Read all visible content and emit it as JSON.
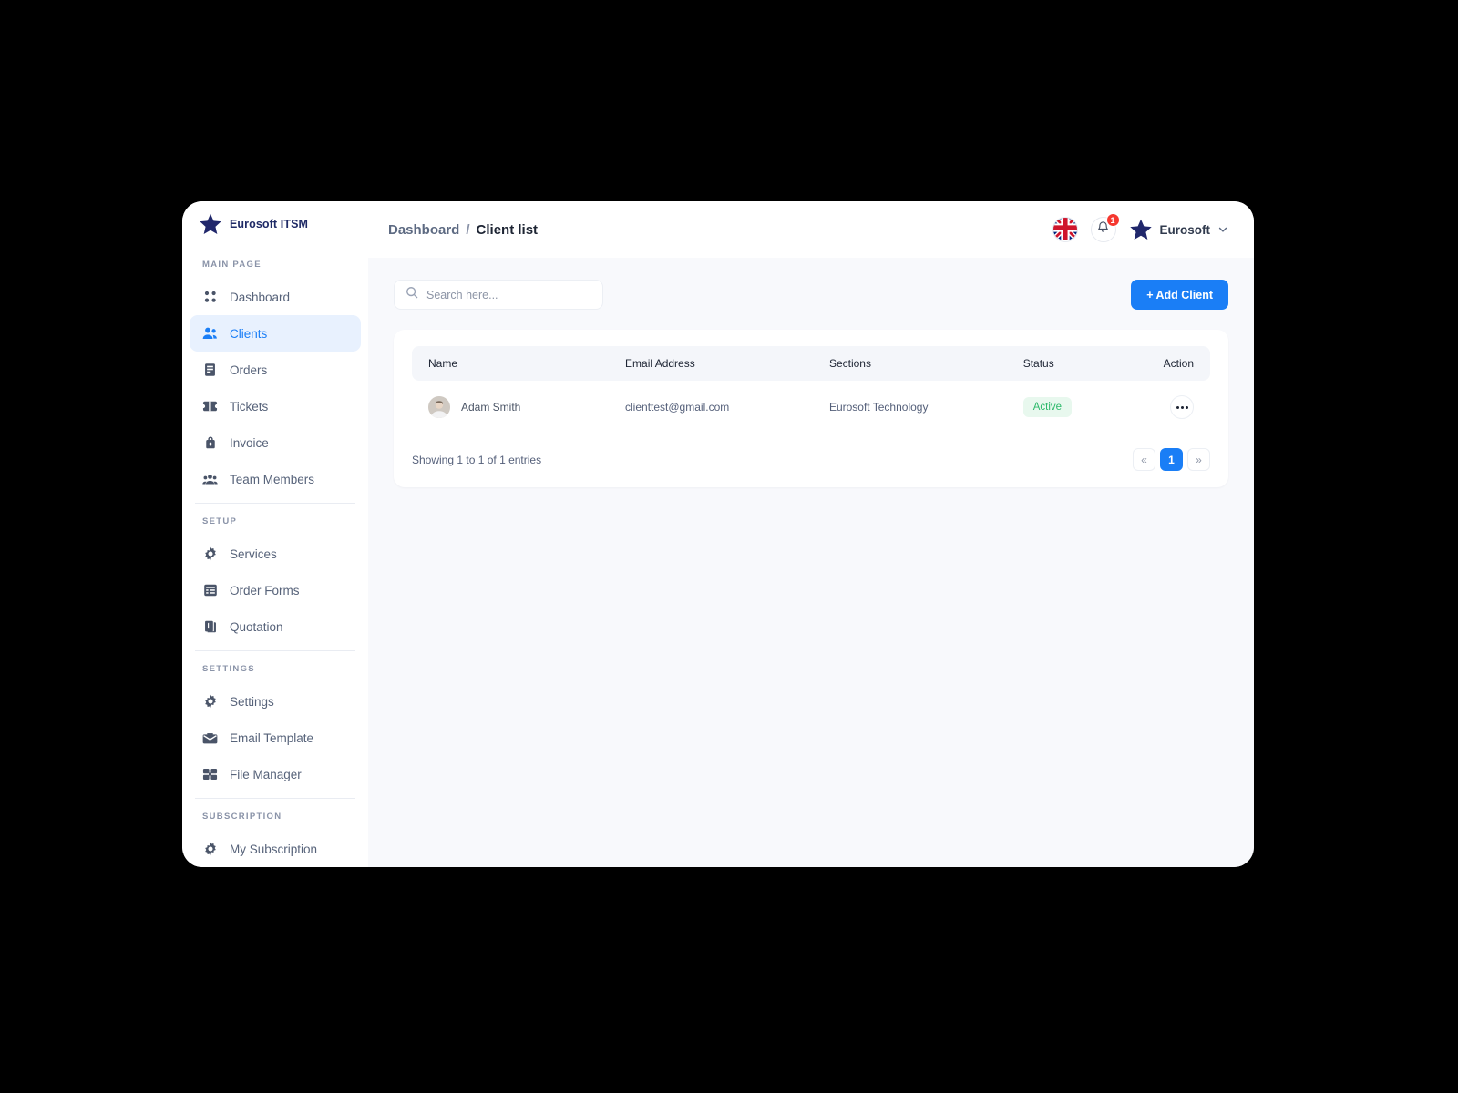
{
  "app": {
    "brand_name": "Eurosoft ITSM",
    "brand_icon": "star-icon"
  },
  "sidebar": {
    "groups": [
      {
        "title": "MAIN PAGE",
        "items": [
          {
            "label": "Dashboard",
            "icon": "grid-dots-icon",
            "active": false
          },
          {
            "label": "Clients",
            "icon": "people-icon",
            "active": true
          },
          {
            "label": "Orders",
            "icon": "document-icon",
            "active": false
          },
          {
            "label": "Tickets",
            "icon": "ticket-icon",
            "active": false
          },
          {
            "label": "Invoice",
            "icon": "invoice-lock-icon",
            "active": false
          },
          {
            "label": "Team Members",
            "icon": "group-icon",
            "active": false
          }
        ]
      },
      {
        "title": "SETUP",
        "items": [
          {
            "label": "Services",
            "icon": "gear-icon",
            "active": false
          },
          {
            "label": "Order Forms",
            "icon": "form-list-icon",
            "active": false
          },
          {
            "label": "Quotation",
            "icon": "quote-doc-icon",
            "active": false
          }
        ]
      },
      {
        "title": "SETTINGS",
        "items": [
          {
            "label": "Settings",
            "icon": "gear-icon",
            "active": false
          },
          {
            "label": "Email Template",
            "icon": "envelope-icon",
            "active": false
          },
          {
            "label": "File Manager",
            "icon": "files-grid-icon",
            "active": false
          }
        ]
      },
      {
        "title": "SUBSCRIPTION",
        "items": [
          {
            "label": "My Subscription",
            "icon": "gear-icon",
            "active": false
          }
        ]
      }
    ]
  },
  "topbar": {
    "breadcrumb_parent": "Dashboard",
    "breadcrumb_separator": "/",
    "breadcrumb_current": "Client list",
    "language_icon": "uk-flag-icon",
    "notification_icon": "bell-icon",
    "notification_count": "1",
    "user_icon": "star-icon",
    "user_name": "Eurosoft",
    "user_chevron_icon": "chevron-down-icon"
  },
  "toolbar": {
    "search_placeholder": "Search here...",
    "search_value": "",
    "search_icon": "search-icon",
    "add_client_label": "+ Add Client"
  },
  "table": {
    "columns": [
      "Name",
      "Email Address",
      "Sections",
      "Status",
      "Action"
    ],
    "rows": [
      {
        "avatar": "user-photo-avatar",
        "name": "Adam Smith",
        "email": "clienttest@gmail.com",
        "sections": "Eurosoft Technology",
        "status": "Active",
        "action_icon": "more-options-icon"
      }
    ],
    "showing_text": "Showing 1 to 1 of 1 entries",
    "pagination": {
      "prev_label": "«",
      "pages": [
        "1"
      ],
      "current_page": "1",
      "next_label": "»"
    }
  },
  "colors": {
    "accent_blue": "#1a7ef6",
    "accent_blue_soft": "#e8f1fe",
    "brand_navy": "#1f2a66",
    "status_green": "#2cb96a",
    "status_green_bg": "#e8f8ee",
    "badge_red": "#f5372f",
    "content_bg": "#f8f9fc",
    "table_head_bg": "#f4f6fa"
  }
}
